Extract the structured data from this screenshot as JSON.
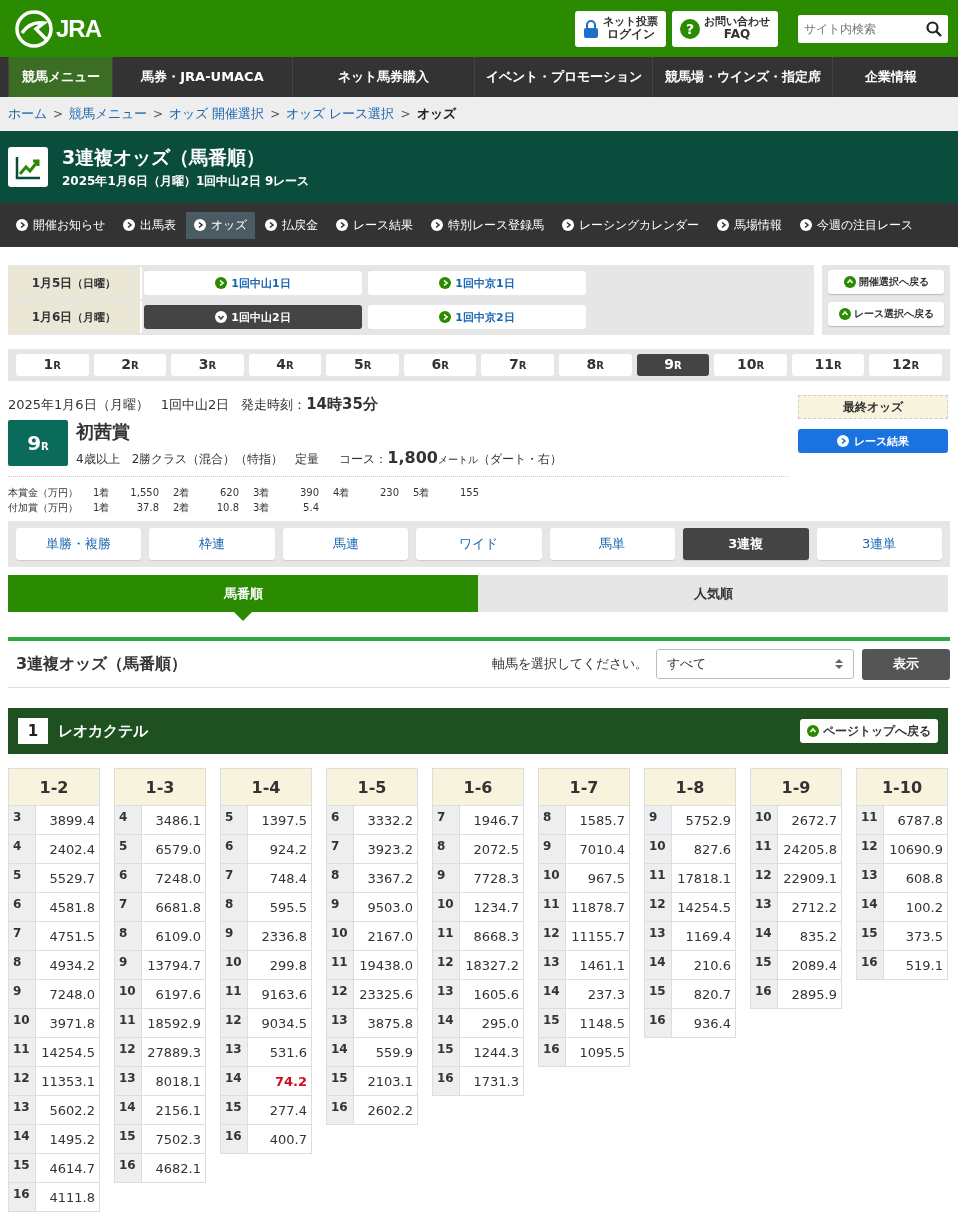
{
  "header": {
    "logo": "JRA",
    "buttons": [
      {
        "kind": "lock",
        "line1": "ネット投票",
        "line2": "ログイン"
      },
      {
        "kind": "help",
        "icon_text": "?",
        "line1": "お問い合わせ",
        "line2": "FAQ"
      }
    ],
    "search": {
      "placeholder": "サイト内検索"
    }
  },
  "main_nav": [
    {
      "label": "競馬メニュー",
      "selected": true
    },
    {
      "label": "馬券・JRA-UMACA",
      "selected": false
    },
    {
      "label": "ネット馬券購入",
      "selected": false
    },
    {
      "label": "イベント・プロモーション",
      "selected": false
    },
    {
      "label": "競馬場・ウインズ・指定席",
      "selected": false
    },
    {
      "label": "企業情報",
      "selected": false
    }
  ],
  "breadcrumb": [
    {
      "label": "ホーム",
      "current": false,
      "separator": ">"
    },
    {
      "label": "競馬メニュー",
      "current": false,
      "separator": ">"
    },
    {
      "label": "オッズ 開催選択",
      "current": false,
      "separator": ">"
    },
    {
      "label": "オッズ レース選択",
      "current": false,
      "separator": ">"
    },
    {
      "label": "オッズ",
      "current": true
    }
  ],
  "page_title": {
    "title": "3連複オッズ（馬番順）",
    "subtitle": "2025年1月6日（月曜）1回中山2日 9レース"
  },
  "sub_nav": [
    {
      "label": "開催お知らせ",
      "selected": false
    },
    {
      "label": "出馬表",
      "selected": false
    },
    {
      "label": "オッズ",
      "selected": true
    },
    {
      "label": "払戻金",
      "selected": false
    },
    {
      "label": "レース結果",
      "selected": false
    },
    {
      "label": "特別レース登録馬",
      "selected": false
    },
    {
      "label": "レーシングカレンダー",
      "selected": false
    },
    {
      "label": "馬場情報",
      "selected": false
    },
    {
      "label": "今週の注目レース",
      "selected": false
    }
  ],
  "meetings": [
    {
      "date": "1月5日",
      "weekday": "（日曜）",
      "venues": [
        {
          "label": "1回中山1日",
          "selected": false
        },
        {
          "label": "1回中京1日",
          "selected": false
        }
      ]
    },
    {
      "date": "1月6日",
      "weekday": "（月曜）",
      "venues": [
        {
          "label": "1回中山2日",
          "selected": true
        },
        {
          "label": "1回中京2日",
          "selected": false
        }
      ]
    }
  ],
  "back_buttons": [
    "開催選択へ戻る",
    "レース選択へ戻る"
  ],
  "races": [
    {
      "num": "1",
      "unit": "R",
      "selected": false
    },
    {
      "num": "2",
      "unit": "R",
      "selected": false
    },
    {
      "num": "3",
      "unit": "R",
      "selected": false
    },
    {
      "num": "4",
      "unit": "R",
      "selected": false
    },
    {
      "num": "5",
      "unit": "R",
      "selected": false
    },
    {
      "num": "6",
      "unit": "R",
      "selected": false
    },
    {
      "num": "7",
      "unit": "R",
      "selected": false
    },
    {
      "num": "8",
      "unit": "R",
      "selected": false
    },
    {
      "num": "9",
      "unit": "R",
      "selected": true
    },
    {
      "num": "10",
      "unit": "R",
      "selected": false
    },
    {
      "num": "11",
      "unit": "R",
      "selected": false
    },
    {
      "num": "12",
      "unit": "R",
      "selected": false
    }
  ],
  "race_info": {
    "date": "2025年1月6日（月曜）",
    "meeting": "1回中山2日",
    "start_label": "発走時刻：",
    "start_time": "14時35分",
    "race_num": "9",
    "race_unit": "R",
    "name": "初茜賞",
    "conditions": [
      "4歳以上",
      "2勝クラス（混合）（特指）",
      "定量"
    ],
    "course_label": "コース：",
    "distance": "1,800",
    "distance_unit": "メートル",
    "course_detail": "（ダート・右）",
    "final_odds": "最終オッズ",
    "result_button": "レース結果"
  },
  "prizes": [
    {
      "label": "本賞金（万円）",
      "places": [
        {
          "place": "1着",
          "amount": "1,550"
        },
        {
          "place": "2着",
          "amount": "620"
        },
        {
          "place": "3着",
          "amount": "390"
        },
        {
          "place": "4着",
          "amount": "230"
        },
        {
          "place": "5着",
          "amount": "155"
        }
      ]
    },
    {
      "label": "付加賞（万円）",
      "places": [
        {
          "place": "1着",
          "amount": "37.8"
        },
        {
          "place": "2着",
          "amount": "10.8"
        },
        {
          "place": "3着",
          "amount": "5.4"
        }
      ]
    }
  ],
  "bet_types": [
    {
      "label": "単勝・複勝",
      "selected": false
    },
    {
      "label": "枠連",
      "selected": false
    },
    {
      "label": "馬連",
      "selected": false
    },
    {
      "label": "ワイド",
      "selected": false
    },
    {
      "label": "馬単",
      "selected": false
    },
    {
      "label": "3連複",
      "selected": true
    },
    {
      "label": "3連単",
      "selected": false
    }
  ],
  "sort_tabs": [
    {
      "label": "馬番順",
      "selected": true
    },
    {
      "label": "人気順",
      "selected": false
    }
  ],
  "odds_heading": {
    "title": "3連複オッズ（馬番順）",
    "axis_label": "軸馬を選択してください。",
    "select_value": "すべて",
    "show_button": "表示"
  },
  "horse": {
    "number": "1",
    "name": "レオカクテル",
    "page_top": "ページトップへ戻る"
  },
  "odds_tables": [
    {
      "pair": "1-2",
      "rows": [
        {
          "horse": "3",
          "odds": "3899.4",
          "highlight": false
        },
        {
          "horse": "4",
          "odds": "2402.4",
          "highlight": false
        },
        {
          "horse": "5",
          "odds": "5529.7",
          "highlight": false
        },
        {
          "horse": "6",
          "odds": "4581.8",
          "highlight": false
        },
        {
          "horse": "7",
          "odds": "4751.5",
          "highlight": false
        },
        {
          "horse": "8",
          "odds": "4934.2",
          "highlight": false
        },
        {
          "horse": "9",
          "odds": "7248.0",
          "highlight": false
        },
        {
          "horse": "10",
          "odds": "3971.8",
          "highlight": false
        },
        {
          "horse": "11",
          "odds": "14254.5",
          "highlight": false
        },
        {
          "horse": "12",
          "odds": "11353.1",
          "highlight": false
        },
        {
          "horse": "13",
          "odds": "5602.2",
          "highlight": false
        },
        {
          "horse": "14",
          "odds": "1495.2",
          "highlight": false
        },
        {
          "horse": "15",
          "odds": "4614.7",
          "highlight": false
        },
        {
          "horse": "16",
          "odds": "4111.8",
          "highlight": false
        }
      ]
    },
    {
      "pair": "1-3",
      "rows": [
        {
          "horse": "4",
          "odds": "3486.1",
          "highlight": false
        },
        {
          "horse": "5",
          "odds": "6579.0",
          "highlight": false
        },
        {
          "horse": "6",
          "odds": "7248.0",
          "highlight": false
        },
        {
          "horse": "7",
          "odds": "6681.8",
          "highlight": false
        },
        {
          "horse": "8",
          "odds": "6109.0",
          "highlight": false
        },
        {
          "horse": "9",
          "odds": "13794.7",
          "highlight": false
        },
        {
          "horse": "10",
          "odds": "6197.6",
          "highlight": false
        },
        {
          "horse": "11",
          "odds": "18592.9",
          "highlight": false
        },
        {
          "horse": "12",
          "odds": "27889.3",
          "highlight": false
        },
        {
          "horse": "13",
          "odds": "8018.1",
          "highlight": false
        },
        {
          "horse": "14",
          "odds": "2156.1",
          "highlight": false
        },
        {
          "horse": "15",
          "odds": "7502.3",
          "highlight": false
        },
        {
          "horse": "16",
          "odds": "4682.1",
          "highlight": false
        }
      ]
    },
    {
      "pair": "1-4",
      "rows": [
        {
          "horse": "5",
          "odds": "1397.5",
          "highlight": false
        },
        {
          "horse": "6",
          "odds": "924.2",
          "highlight": false
        },
        {
          "horse": "7",
          "odds": "748.4",
          "highlight": false
        },
        {
          "horse": "8",
          "odds": "595.5",
          "highlight": false
        },
        {
          "horse": "9",
          "odds": "2336.8",
          "highlight": false
        },
        {
          "horse": "10",
          "odds": "299.8",
          "highlight": false
        },
        {
          "horse": "11",
          "odds": "9163.6",
          "highlight": false
        },
        {
          "horse": "12",
          "odds": "9034.5",
          "highlight": false
        },
        {
          "horse": "13",
          "odds": "531.6",
          "highlight": false
        },
        {
          "horse": "14",
          "odds": "74.2",
          "highlight": true
        },
        {
          "horse": "15",
          "odds": "277.4",
          "highlight": false
        },
        {
          "horse": "16",
          "odds": "400.7",
          "highlight": false
        }
      ]
    },
    {
      "pair": "1-5",
      "rows": [
        {
          "horse": "6",
          "odds": "3332.2",
          "highlight": false
        },
        {
          "horse": "7",
          "odds": "3923.2",
          "highlight": false
        },
        {
          "horse": "8",
          "odds": "3367.2",
          "highlight": false
        },
        {
          "horse": "9",
          "odds": "9503.0",
          "highlight": false
        },
        {
          "horse": "10",
          "odds": "2167.0",
          "highlight": false
        },
        {
          "horse": "11",
          "odds": "19438.0",
          "highlight": false
        },
        {
          "horse": "12",
          "odds": "23325.6",
          "highlight": false
        },
        {
          "horse": "13",
          "odds": "3875.8",
          "highlight": false
        },
        {
          "horse": "14",
          "odds": "559.9",
          "highlight": false
        },
        {
          "horse": "15",
          "odds": "2103.1",
          "highlight": false
        },
        {
          "horse": "16",
          "odds": "2602.2",
          "highlight": false
        }
      ]
    },
    {
      "pair": "1-6",
      "rows": [
        {
          "horse": "7",
          "odds": "1946.7",
          "highlight": false
        },
        {
          "horse": "8",
          "odds": "2072.5",
          "highlight": false
        },
        {
          "horse": "9",
          "odds": "7728.3",
          "highlight": false
        },
        {
          "horse": "10",
          "odds": "1234.7",
          "highlight": false
        },
        {
          "horse": "11",
          "odds": "8668.3",
          "highlight": false
        },
        {
          "horse": "12",
          "odds": "18327.2",
          "highlight": false
        },
        {
          "horse": "13",
          "odds": "1605.6",
          "highlight": false
        },
        {
          "horse": "14",
          "odds": "295.0",
          "highlight": false
        },
        {
          "horse": "15",
          "odds": "1244.3",
          "highlight": false
        },
        {
          "horse": "16",
          "odds": "1731.3",
          "highlight": false
        }
      ]
    },
    {
      "pair": "1-7",
      "rows": [
        {
          "horse": "8",
          "odds": "1585.7",
          "highlight": false
        },
        {
          "horse": "9",
          "odds": "7010.4",
          "highlight": false
        },
        {
          "horse": "10",
          "odds": "967.5",
          "highlight": false
        },
        {
          "horse": "11",
          "odds": "11878.7",
          "highlight": false
        },
        {
          "horse": "12",
          "odds": "11155.7",
          "highlight": false
        },
        {
          "horse": "13",
          "odds": "1461.1",
          "highlight": false
        },
        {
          "horse": "14",
          "odds": "237.3",
          "highlight": false
        },
        {
          "horse": "15",
          "odds": "1148.5",
          "highlight": false
        },
        {
          "horse": "16",
          "odds": "1095.5",
          "highlight": false
        }
      ]
    },
    {
      "pair": "1-8",
      "rows": [
        {
          "horse": "9",
          "odds": "5752.9",
          "highlight": false
        },
        {
          "horse": "10",
          "odds": "827.6",
          "highlight": false
        },
        {
          "horse": "11",
          "odds": "17818.1",
          "highlight": false
        },
        {
          "horse": "12",
          "odds": "14254.5",
          "highlight": false
        },
        {
          "horse": "13",
          "odds": "1169.4",
          "highlight": false
        },
        {
          "horse": "14",
          "odds": "210.6",
          "highlight": false
        },
        {
          "horse": "15",
          "odds": "820.7",
          "highlight": false
        },
        {
          "horse": "16",
          "odds": "936.4",
          "highlight": false
        }
      ]
    },
    {
      "pair": "1-9",
      "rows": [
        {
          "horse": "10",
          "odds": "2672.7",
          "highlight": false
        },
        {
          "horse": "11",
          "odds": "24205.8",
          "highlight": false
        },
        {
          "horse": "12",
          "odds": "22909.1",
          "highlight": false
        },
        {
          "horse": "13",
          "odds": "2712.2",
          "highlight": false
        },
        {
          "horse": "14",
          "odds": "835.2",
          "highlight": false
        },
        {
          "horse": "15",
          "odds": "2089.4",
          "highlight": false
        },
        {
          "horse": "16",
          "odds": "2895.9",
          "highlight": false
        }
      ]
    },
    {
      "pair": "1-10",
      "rows": [
        {
          "horse": "11",
          "odds": "6787.8",
          "highlight": false
        },
        {
          "horse": "12",
          "odds": "10690.9",
          "highlight": false
        },
        {
          "horse": "13",
          "odds": "608.8",
          "highlight": false
        },
        {
          "horse": "14",
          "odds": "100.2",
          "highlight": false
        },
        {
          "horse": "15",
          "odds": "373.5",
          "highlight": false
        },
        {
          "horse": "16",
          "odds": "519.1",
          "highlight": false
        }
      ]
    }
  ]
}
